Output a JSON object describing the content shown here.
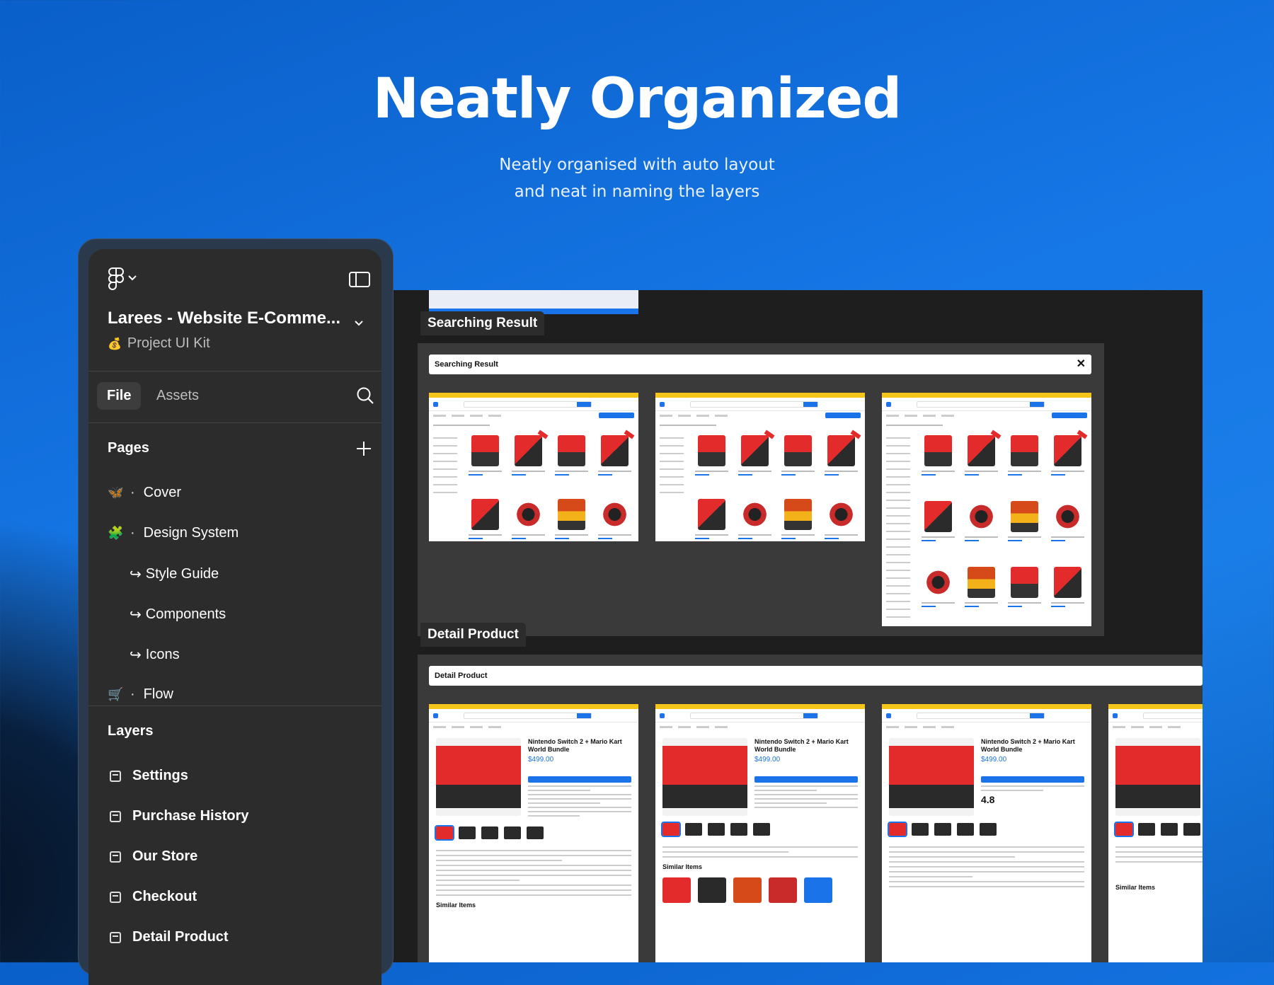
{
  "hero": {
    "title": "Neatly Organized",
    "subtitle_line1": "Neatly organised with auto layout",
    "subtitle_line2": "and neat in naming the layers"
  },
  "panel": {
    "project_title": "Larees - Website E-Comme...",
    "project_subtitle": "Project UI Kit",
    "tabs": {
      "file": "File",
      "assets": "Assets"
    },
    "pages_heading": "Pages",
    "pages": [
      {
        "label": "Cover",
        "icon": "butterfly-icon"
      },
      {
        "label": "Design System",
        "icon": "puzzle-icon"
      }
    ],
    "subpages": [
      {
        "label": "Style Guide"
      },
      {
        "label": "Components"
      },
      {
        "label": "Icons"
      }
    ],
    "flow_page": {
      "label": "Flow",
      "icon": "cart-icon"
    },
    "layers_heading": "Layers",
    "layers": [
      {
        "label": "Settings"
      },
      {
        "label": "Purchase History"
      },
      {
        "label": "Our Store"
      },
      {
        "label": "Checkout"
      },
      {
        "label": "Detail Product"
      }
    ]
  },
  "canvas": {
    "searching_label": "Searching Result",
    "searching_header": "Searching Result",
    "detail_label": "Detail Product",
    "detail_header": "Detail Product",
    "detail_product_title": "Nintendo Switch 2 + Mario Kart World Bundle",
    "detail_price": "$499.00",
    "similar_items": "Similar Items",
    "rating": "4.8"
  },
  "colors": {
    "background_blue": "#1677e6",
    "panel_bg": "#2c2c2c",
    "accent_blue": "#1a73e8",
    "promo_yellow": "#f5c518"
  }
}
